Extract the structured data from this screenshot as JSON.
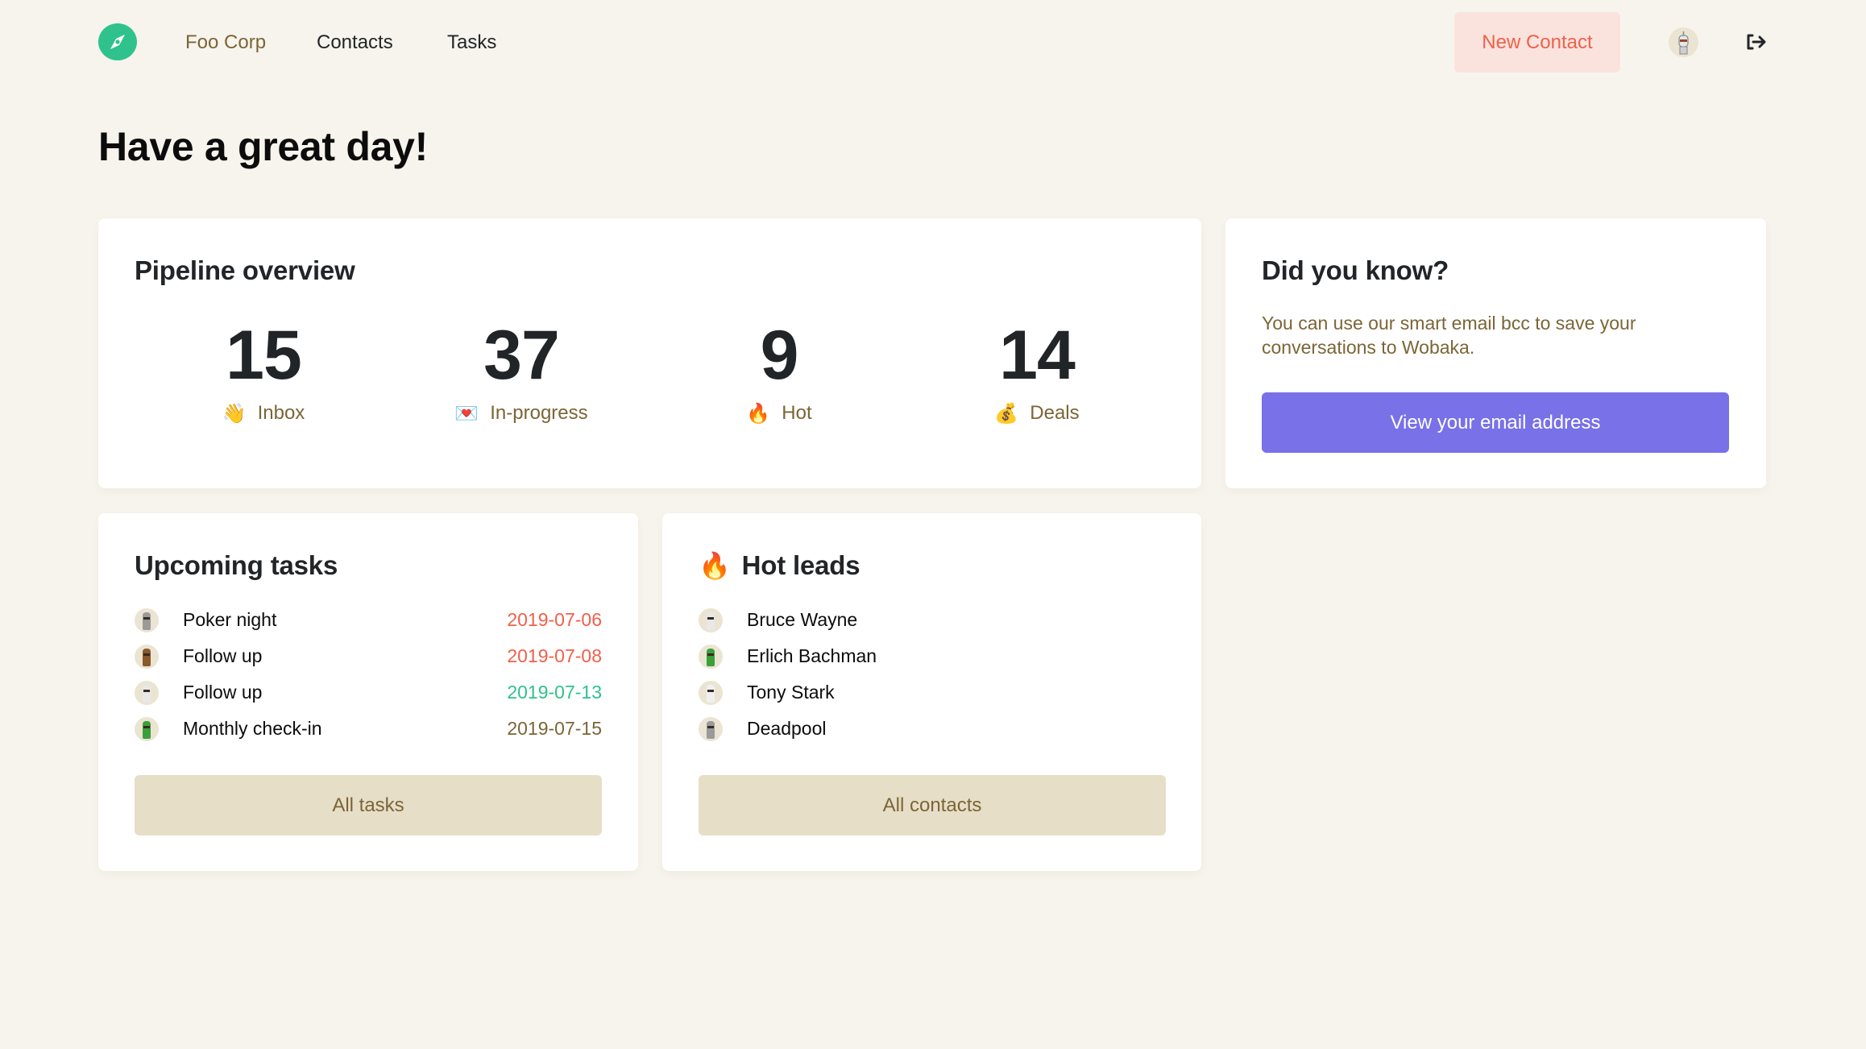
{
  "nav": {
    "logo_icon": "compass-icon",
    "links": [
      {
        "label": "Foo Corp"
      },
      {
        "label": "Contacts"
      },
      {
        "label": "Tasks"
      }
    ],
    "new_contact_label": "New Contact",
    "avatar_icon": "robot-avatar",
    "logout_icon": "sign-out-icon"
  },
  "page": {
    "title": "Have a great day!"
  },
  "pipeline": {
    "title": "Pipeline overview",
    "stats": [
      {
        "value": "15",
        "label": "Inbox",
        "emoji": "👋",
        "icon": "waving-hand-icon"
      },
      {
        "value": "37",
        "label": "In-progress",
        "emoji": "💌",
        "icon": "love-letter-icon"
      },
      {
        "value": "9",
        "label": "Hot",
        "emoji": "🔥",
        "icon": "fire-icon"
      },
      {
        "value": "14",
        "label": "Deals",
        "emoji": "💰",
        "icon": "money-bag-icon"
      }
    ]
  },
  "tip": {
    "title": "Did you know?",
    "text": "You can use our smart email bcc to save your conversations to Wobaka.",
    "button_label": "View your email address"
  },
  "tasks": {
    "title": "Upcoming tasks",
    "items": [
      {
        "title": "Poker night",
        "date": "2019-07-06",
        "date_color": "#f0604a",
        "avatar_color": "#9a9a9a"
      },
      {
        "title": "Follow up",
        "date": "2019-07-08",
        "date_color": "#f0604a",
        "avatar_color": "#8a5a2a"
      },
      {
        "title": "Follow up",
        "date": "2019-07-13",
        "date_color": "#2fc28c",
        "avatar_color": "#e8e8e8"
      },
      {
        "title": "Monthly check-in",
        "date": "2019-07-15",
        "date_color": "#7b6536",
        "avatar_color": "#3aa03a"
      }
    ],
    "button_label": "All tasks"
  },
  "leads": {
    "title": "Hot leads",
    "emoji": "🔥",
    "items": [
      {
        "name": "Bruce Wayne",
        "avatar_color": "#e8e8e8"
      },
      {
        "name": "Erlich Bachman",
        "avatar_color": "#3aa03a"
      },
      {
        "name": "Tony Stark",
        "avatar_color": "#f0f0f0"
      },
      {
        "name": "Deadpool",
        "avatar_color": "#9a9a9a"
      }
    ],
    "button_label": "All contacts"
  },
  "colors": {
    "background": "#f7f4ed",
    "brand_green": "#2fc28c",
    "accent_purple": "#7871e8",
    "danger_red": "#f0604a",
    "muted_brown": "#7b6536",
    "secondary_button": "#e7dec8",
    "new_contact_bg": "#fbe3dd"
  }
}
